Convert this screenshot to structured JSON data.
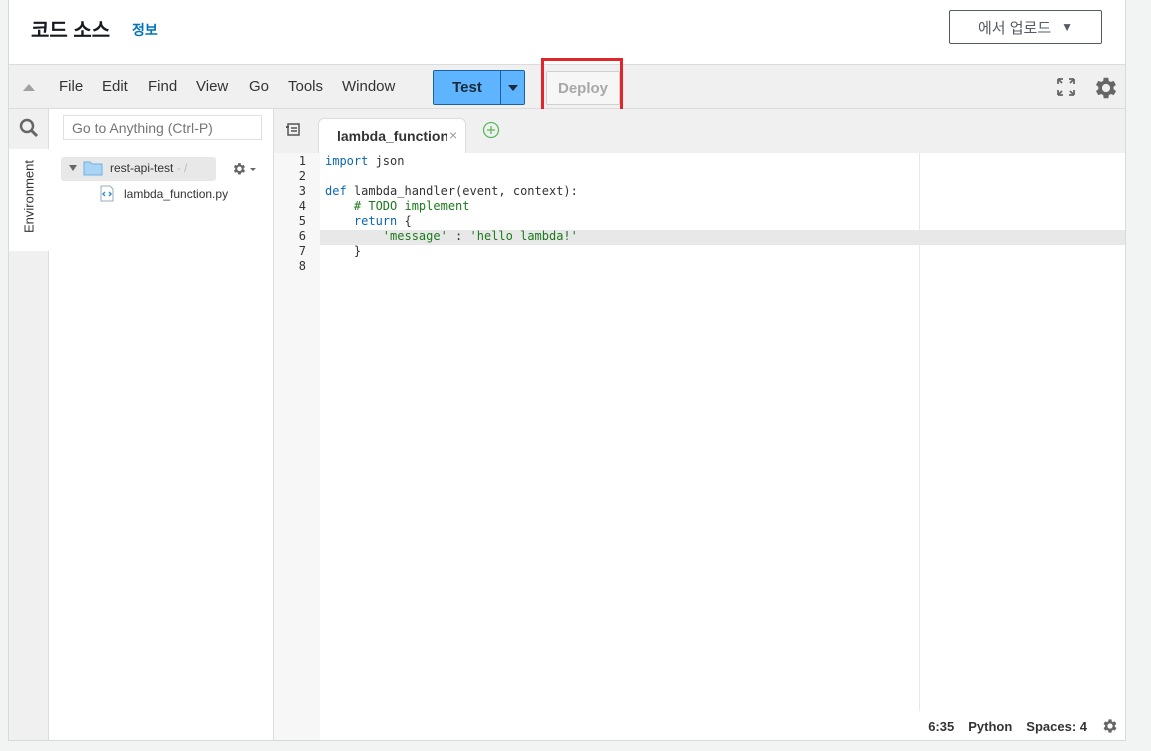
{
  "header": {
    "title": "코드 소스",
    "info_link": "정보",
    "upload_label": "에서 업로드",
    "upload_caret": "▼"
  },
  "menubar": {
    "items": [
      "File",
      "Edit",
      "Find",
      "View",
      "Go",
      "Tools",
      "Window"
    ],
    "test_label": "Test",
    "deploy_label": "Deploy"
  },
  "sidebar": {
    "environment_tab": "Environment",
    "goto_placeholder": "Go to Anything (Ctrl-P)",
    "root_folder": "rest-api-test",
    "root_suffix": " - /",
    "file": "lambda_function.py"
  },
  "editor": {
    "tab_label": "lambda_function",
    "tab_close": "×",
    "line_numbers": [
      "1",
      "2",
      "3",
      "4",
      "5",
      "6",
      "7",
      "8"
    ],
    "code": {
      "l1_kw": "import",
      "l1_rest": " json",
      "l3_kw": "def",
      "l3_rest": " lambda_handler(event, context):",
      "l4_comment": "    # TODO implement",
      "l5_kw": "    return",
      "l5_rest": " {",
      "l6_indent": "        ",
      "l6_key": "'message'",
      "l6_sep": " : ",
      "l6_val": "'hello lambda!'",
      "l7": "    }"
    }
  },
  "statusbar": {
    "position": "6:35",
    "language": "Python",
    "spaces": "Spaces: 4"
  },
  "colors": {
    "test_button": "#5eb4ff",
    "highlight_box": "#e1262b",
    "link": "#0073bb"
  }
}
